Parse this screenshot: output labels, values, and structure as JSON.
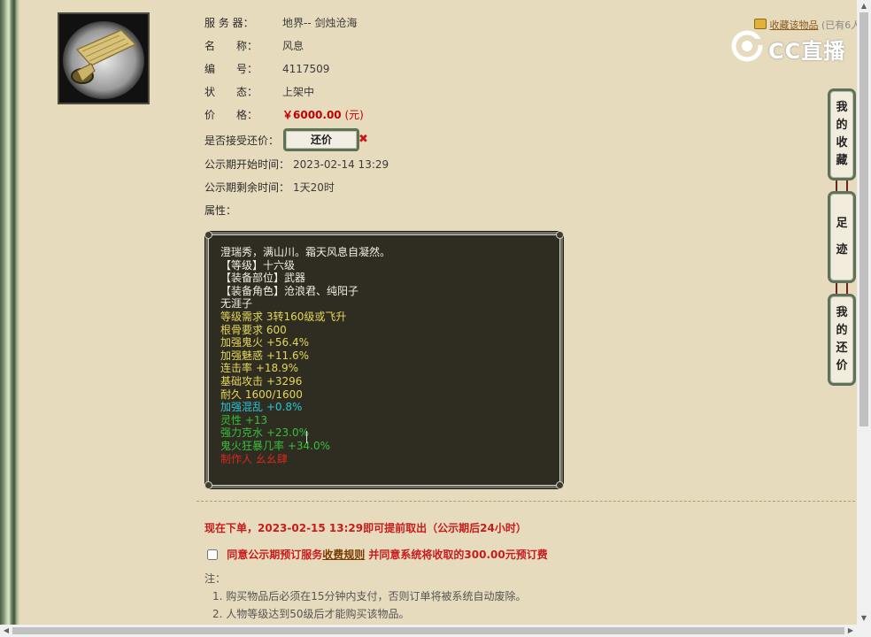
{
  "item": {
    "server_label": "服 务 器：",
    "server": "地界-- 剑烛沧海",
    "name_label": "名　　称：",
    "name": "风息",
    "id_label": "编　　号：",
    "id": "4117509",
    "status_label": "状　　态：",
    "status": "上架中",
    "price_label": "价　　格：",
    "price": "￥6000.00",
    "price_unit": "(元)",
    "bargain_label": "是否接受还价：",
    "bargain_button": "还价",
    "bargain_close": "✖",
    "public_start_label": "公示期开始时间：",
    "public_start": "2023-02-14 13:29",
    "public_remain_label": "公示期剩余时间：",
    "public_remain": "1天20时",
    "attr_label": "属性："
  },
  "attributes": [
    {
      "text": "澄瑞秀，满山川。霜天风息自凝然。",
      "color": "#f1efe5"
    },
    {
      "text": "【等级】十六级",
      "color": "#f1efe5"
    },
    {
      "text": "【装备部位】武器",
      "color": "#f1efe5"
    },
    {
      "text": "【装备角色】沧浪君、纯阳子",
      "color": "#f1efe5"
    },
    {
      "text": "无涯子",
      "color": "#f1efe5"
    },
    {
      "text": "等级需求 3转160级或飞升",
      "color": "#e5d75a"
    },
    {
      "text": "根骨要求 600",
      "color": "#e5d75a"
    },
    {
      "text": "加强鬼火 +56.4%",
      "color": "#e5d75a"
    },
    {
      "text": "加强魅惑 +11.6%",
      "color": "#e5d75a"
    },
    {
      "text": "连击率 +18.9%",
      "color": "#e5d75a"
    },
    {
      "text": "基础攻击 +3296",
      "color": "#e5d75a"
    },
    {
      "text": "耐久 1600/1600",
      "color": "#e5d75a"
    },
    {
      "text": "加强混乱 +0.8%",
      "color": "#28c6d8"
    },
    {
      "text": "灵性 +13",
      "color": "#36c03a"
    },
    {
      "text": "强力克水 +23.0%",
      "color": "#36c03a"
    },
    {
      "text": "鬼火狂暴几率 +34.0%",
      "color": "#36c03a"
    },
    {
      "text": "制作人 幺幺肆",
      "color": "#d22a1e"
    }
  ],
  "order": {
    "note": "现在下单，2023-02-15 13:29即可提前取出（公示期后24小时）",
    "agree_prefix": "同意公示期预订服务",
    "agree_link": "收费规则",
    "agree_suffix": " 并同意系统将收取的300.00元预订费",
    "notes_title": "注：",
    "notes": [
      "1. 购买物品后必须在15分钟内支付，否则订单将被系统自动废除。",
      "2. 人物等级达到50级后才能购买该物品。"
    ]
  },
  "favorite": {
    "link": "收藏该物品",
    "count": "(已有6人"
  },
  "watermark": {
    "text": "CC直播"
  },
  "side_tabs": [
    {
      "label": "我的收藏",
      "chars": [
        "我",
        "的",
        "收",
        "藏"
      ]
    },
    {
      "label": "足迹",
      "chars": [
        "足",
        "迹"
      ]
    },
    {
      "label": "我的还价",
      "chars": [
        "我",
        "的",
        "还",
        "价"
      ]
    }
  ]
}
